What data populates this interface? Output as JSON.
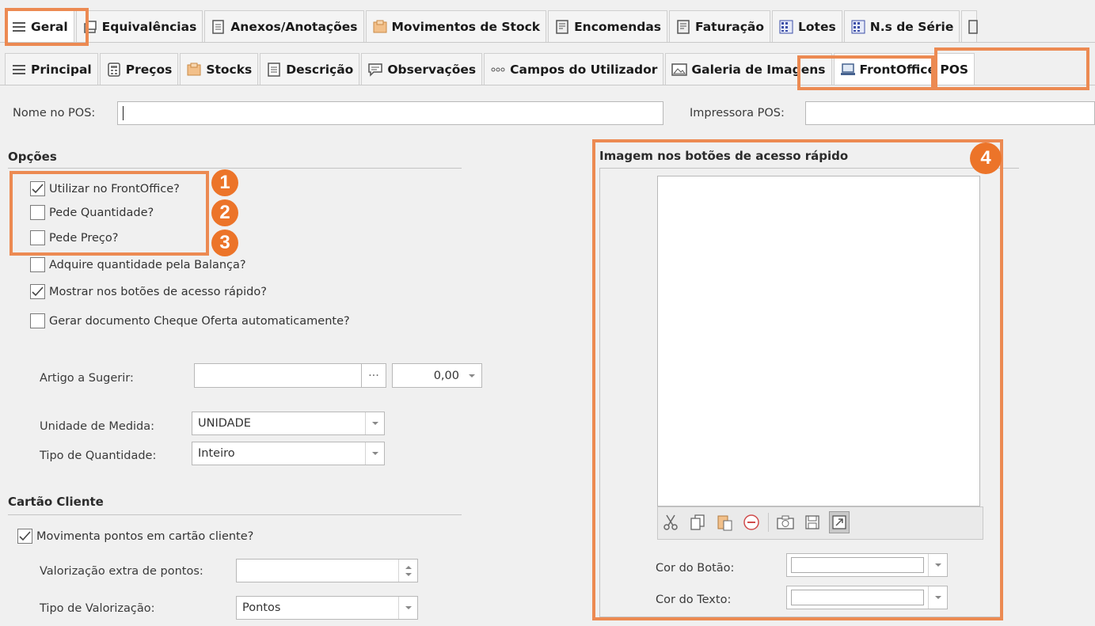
{
  "tabs_main": [
    {
      "label": "Geral",
      "icon": "list-icon",
      "active": true
    },
    {
      "label": "Equivalências",
      "icon": "window-icon"
    },
    {
      "label": "Anexos/Anotações",
      "icon": "document-icon"
    },
    {
      "label": "Movimentos de Stock",
      "icon": "box-icon"
    },
    {
      "label": "Encomendas",
      "icon": "ledger-icon"
    },
    {
      "label": "Faturação",
      "icon": "ledger-icon"
    },
    {
      "label": "Lotes",
      "icon": "grid-numbers-icon"
    },
    {
      "label": "N.s de Série",
      "icon": "grid-numbers-icon"
    }
  ],
  "tabs_sub": [
    {
      "label": "Principal",
      "icon": "list-icon"
    },
    {
      "label": "Preços",
      "icon": "calculator-icon"
    },
    {
      "label": "Stocks",
      "icon": "box-icon"
    },
    {
      "label": "Descrição",
      "icon": "document-icon"
    },
    {
      "label": "Observações",
      "icon": "comment-icon"
    },
    {
      "label": "Campos do Utilizador",
      "icon": "dots-icon"
    },
    {
      "label": "Galeria de Imagens",
      "icon": "image-icon"
    },
    {
      "label": "FrontOffice POS",
      "icon": "laptop-icon",
      "active": true
    }
  ],
  "pos": {
    "name_label": "Nome no POS:",
    "name_value": "",
    "printer_label": "Impressora POS:",
    "printer_value": ""
  },
  "options": {
    "title": "Opções",
    "items": [
      {
        "label": "Utilizar no FrontOffice?",
        "checked": true
      },
      {
        "label": "Pede Quantidade?",
        "checked": false
      },
      {
        "label": "Pede Preço?",
        "checked": false
      },
      {
        "label": "Adquire quantidade pela Balança?",
        "checked": false
      },
      {
        "label": "Mostrar nos botões de acesso rápido?",
        "checked": true
      },
      {
        "label": "Gerar documento Cheque Oferta automaticamente?",
        "checked": false
      }
    ]
  },
  "suggest": {
    "label": "Artigo a Sugerir:",
    "value": "",
    "browse": "···",
    "quantity": "0,00"
  },
  "unit": {
    "label": "Unidade de Medida:",
    "value": "UNIDADE"
  },
  "qty_type": {
    "label": "Tipo de Quantidade:",
    "value": "Inteiro"
  },
  "card": {
    "title": "Cartão Cliente",
    "move_points_label": "Movimenta pontos em cartão cliente?",
    "move_points_checked": true,
    "extra_label": "Valorização extra de pontos:",
    "extra_value": "",
    "type_label": "Tipo de Valorização:",
    "type_value": "Pontos"
  },
  "image_panel": {
    "title": "Imagem nos botões de acesso rápido",
    "button_color_label": "Cor do Botão:",
    "text_color_label": "Cor do Texto:",
    "toolbar": [
      "scissors-icon",
      "copy-icon",
      "paste-icon",
      "remove-icon",
      "camera-icon",
      "save-icon",
      "stretch-icon"
    ]
  },
  "markers": [
    "1",
    "2",
    "3",
    "4"
  ],
  "highlight_color": "#ec8a52",
  "marker_color": "#ec7429"
}
